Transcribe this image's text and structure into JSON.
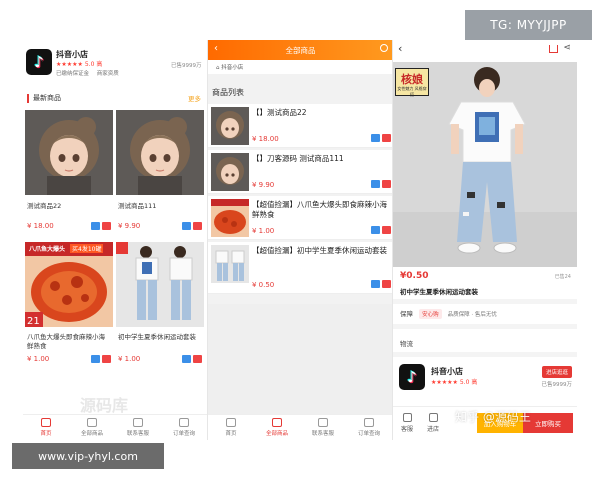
{
  "overlay": {
    "tg_label": "TG: MYYJJPP",
    "url_label": "www.vip-yhyl.com",
    "watermark_left": "源码库",
    "watermark_right": "知乎 @源码王"
  },
  "panel1": {
    "shop": {
      "name": "抖音小店",
      "stars": "★★★★★",
      "rating": "5.0 高",
      "sold": "已售9999万",
      "tag1": "已缴纳保证金",
      "tag2": "商家资质"
    },
    "section": {
      "title": "最新商品",
      "more": "更多"
    },
    "products": [
      {
        "name": "测试商品22",
        "price": "¥ 18.00"
      },
      {
        "name": "测试商品111",
        "price": "¥ 9.90"
      },
      {
        "name": "八爪鱼大爆头即食麻辣小海鲜熟食",
        "price": "¥ 1.00"
      },
      {
        "name": "初中学生夏季休闲运动套装",
        "price": "¥ 1.00"
      }
    ],
    "promo": {
      "line1": "八爪鱼大爆头",
      "line2": "买4发10罐",
      "num": "21"
    },
    "tabs": [
      "首页",
      "全部商品",
      "联系客服",
      "订单查询"
    ]
  },
  "panel2": {
    "title": "全部商品",
    "shop_line": "抖音小店",
    "list_header": "商品列表",
    "items": [
      {
        "name": "【】测试商品22",
        "price": "¥ 18.00"
      },
      {
        "name": "【】刀客源码 测试商品111",
        "price": "¥ 9.90"
      },
      {
        "name": "【超值捡漏】八爪鱼大爆头即食麻辣小海鲜熟食",
        "price": "¥ 1.00"
      },
      {
        "name": "【超值捡漏】初中学生夏季休闲运动套装",
        "price": "¥ 0.50"
      }
    ],
    "tabs": [
      "首页",
      "全部商品",
      "联系客服",
      "订单查询"
    ]
  },
  "panel3": {
    "brand_big": "核娘",
    "brand_small": "女性魅力 风格穿搭",
    "price": "¥0.50",
    "stock": "已售24",
    "title": "初中学生夏季休闲运动套装",
    "guarantee_label": "保障",
    "guarantee_badge": "安心购",
    "guarantee_desc": "品质保障 · 售后无忧",
    "logistics_label": "物流",
    "shop": {
      "name": "抖音小店",
      "stars": "★★★★★",
      "rating": "5.0 高",
      "enter": "进店逛逛",
      "sold": "已售9999万"
    },
    "bottom": {
      "service": "客服",
      "store": "进店",
      "add_cart": "加入购物车",
      "buy_now": "立即购买"
    }
  },
  "colors": {
    "accent_red": "#e53935",
    "orange": "#ff7a0a",
    "blue_button": "#3b8fe8"
  }
}
